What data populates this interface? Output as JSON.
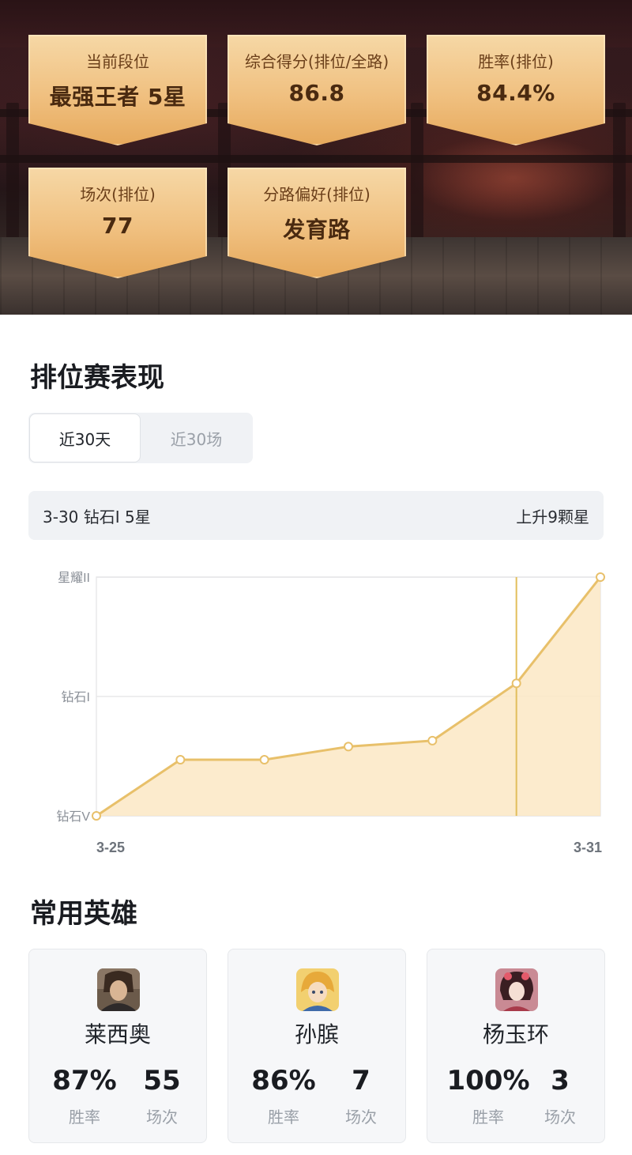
{
  "summary": {
    "rank": {
      "label": "当前段位",
      "value": "最强王者 5星"
    },
    "score": {
      "label": "综合得分(排位/全路)",
      "value": "86.8"
    },
    "winrate": {
      "label": "胜率(排位)",
      "value": "84.4%"
    },
    "matches": {
      "label": "场次(排位)",
      "value": "77"
    },
    "lane": {
      "label": "分路偏好(排位)",
      "value": "发育路"
    }
  },
  "ranked": {
    "title": "排位赛表现",
    "tabs": [
      {
        "label": "近30天",
        "active": true
      },
      {
        "label": "近30场",
        "active": false
      }
    ],
    "info": {
      "left": "3-30 钻石I 5星",
      "right": "上升9颗星"
    }
  },
  "chart_data": {
    "type": "area",
    "x_start_label": "3-25",
    "x_end_label": "3-31",
    "y_tick_labels": [
      "钻石V",
      "钻石I",
      "星耀II"
    ],
    "y_range": [
      0,
      2
    ],
    "x": [
      "3-25",
      "3-26",
      "3-27",
      "3-28",
      "3-29",
      "3-30",
      "3-31"
    ],
    "values": [
      0,
      0.47,
      0.47,
      0.58,
      0.63,
      1.11,
      2.0
    ],
    "highlight_index": 5,
    "colors": {
      "line": "#e8c06a",
      "fill": "#fbe8c4",
      "guide": "#e2be5c",
      "grid": "#e8e8ea"
    }
  },
  "heroes": {
    "title": "常用英雄",
    "stat_labels": {
      "winrate": "胜率",
      "matches": "场次"
    },
    "items": [
      {
        "name": "莱西奥",
        "winrate": "87%",
        "matches": "55"
      },
      {
        "name": "孙膑",
        "winrate": "86%",
        "matches": "7"
      },
      {
        "name": "杨玉环",
        "winrate": "100%",
        "matches": "3"
      }
    ]
  }
}
